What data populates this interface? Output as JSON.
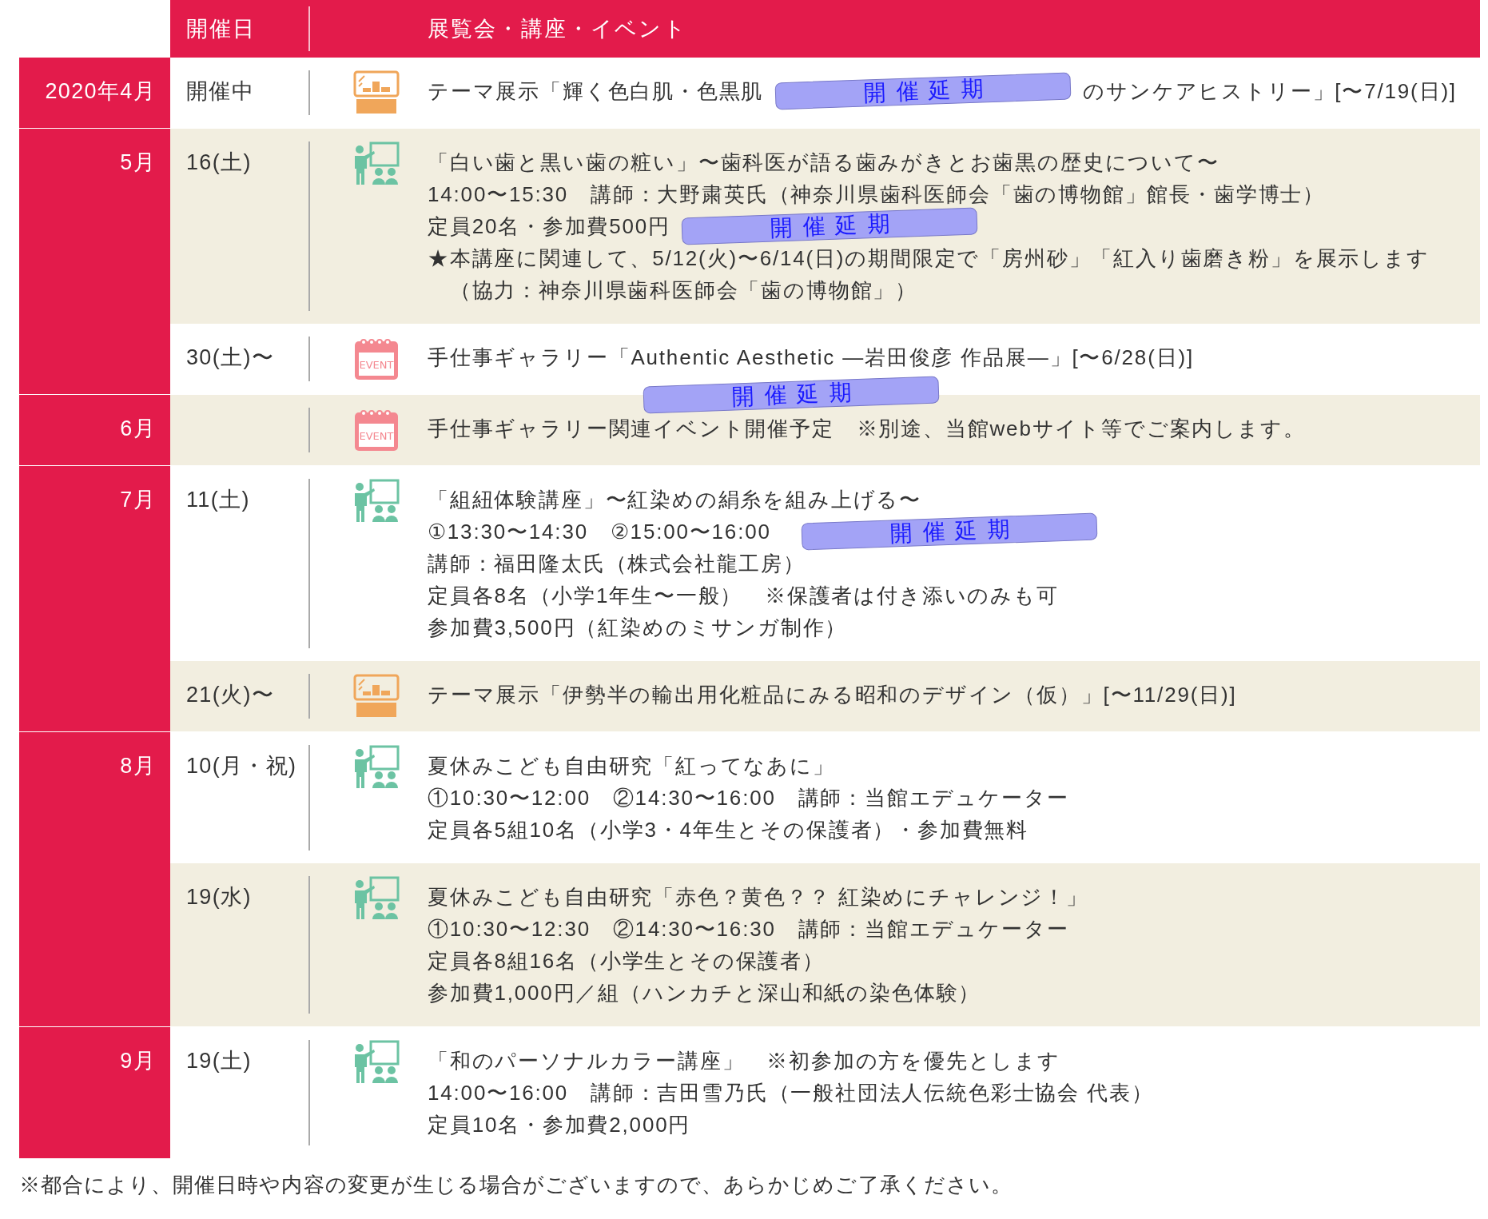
{
  "header": {
    "date_column": "開催日",
    "event_column": "展覧会・講座・イベント"
  },
  "months": [
    {
      "label": "2020年4月",
      "entries": [
        {
          "date": "開催中",
          "kind": "exhibit",
          "segments": [
            "テーマ展示「輝く色白肌・色黒肌",
            "のサンケアヒストリー」[〜7/19(日)]"
          ],
          "stamp": "開催延期"
        }
      ]
    },
    {
      "label": "5月",
      "entries": [
        {
          "date": "16(土)",
          "kind": "lecture",
          "lines": [
            "「白い歯と黒い歯の粧い」〜歯科医が語る歯みがきとお歯黒の歴史について〜",
            "14:00〜15:30　講師：大野粛英氏（神奈川県歯科医師会「歯の博物館」館長・歯学博士）",
            "定員20名・参加費500円",
            "★本講座に関連して、5/12(火)〜6/14(日)の期間限定で「房州砂」「紅入り歯磨き粉」を展示します",
            "　（協力：神奈川県歯科医師会「歯の博物館」）"
          ],
          "stamp": "開催延期"
        },
        {
          "date": "30(土)〜",
          "kind": "event",
          "icon_label": "EVENT",
          "lines": [
            "手仕事ギャラリー「Authentic Aesthetic ―岩田俊彦 作品展―」[〜6/28(日)]"
          ]
        }
      ]
    },
    {
      "label": "6月",
      "entries": [
        {
          "kind": "event",
          "icon_label": "EVENT",
          "lines": [
            "手仕事ギャラリー関連イベント開催予定　※別途、当館webサイト等でご案内します。"
          ],
          "stamp": "開催延期"
        }
      ]
    },
    {
      "label": "7月",
      "entries": [
        {
          "date": "11(土)",
          "kind": "lecture",
          "lines": [
            "「組紐体験講座」〜紅染めの絹糸を組み上げる〜",
            "①13:30〜14:30　②15:00〜16:00",
            "講師：福田隆太氏（株式会社龍工房）",
            "定員各8名（小学1年生〜一般）　※保護者は付き添いのみも可",
            "参加費3,500円（紅染めのミサンガ制作）"
          ],
          "stamp": "開催延期"
        },
        {
          "date": "21(火)〜",
          "kind": "exhibit",
          "lines": [
            "テーマ展示「伊勢半の輸出用化粧品にみる昭和のデザイン（仮）」[〜11/29(日)]"
          ]
        }
      ]
    },
    {
      "label": "8月",
      "entries": [
        {
          "date": "10(月・祝)",
          "kind": "lecture",
          "lines": [
            "夏休みこども自由研究「紅ってなあに」",
            "①10:30〜12:00　②14:30〜16:00　講師：当館エデュケーター",
            "定員各5組10名（小学3・4年生とその保護者）・参加費無料"
          ]
        },
        {
          "date": "19(水)",
          "kind": "lecture",
          "lines": [
            "夏休みこども自由研究「赤色？黄色？？ 紅染めにチャレンジ！」",
            "①10:30〜12:30　②14:30〜16:30　講師：当館エデュケーター",
            "定員各8組16名（小学生とその保護者）",
            "参加費1,000円／組（ハンカチと深山和紙の染色体験）"
          ]
        }
      ]
    },
    {
      "label": "9月",
      "entries": [
        {
          "date": "19(土)",
          "kind": "lecture",
          "lines": [
            "「和のパーソナルカラー講座」　※初参加の方を優先とします",
            "14:00〜16:00　講師：吉田雪乃氏（一般社団法人伝統色彩士協会 代表）",
            "定員10名・参加費2,000円"
          ]
        }
      ]
    }
  ],
  "footnote": "※都合により、開催日時や内容の変更が生じる場合がございますので、あらかじめご了承ください。"
}
